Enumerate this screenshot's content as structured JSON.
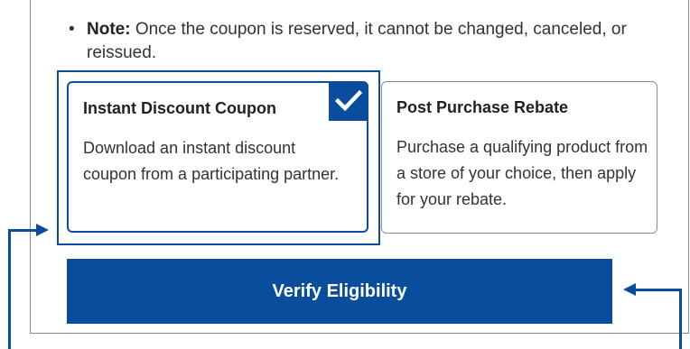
{
  "note": {
    "bullet": "•",
    "label": "Note:",
    "text": " Once the coupon is reserved, it cannot be changed, canceled, or reissued."
  },
  "options": [
    {
      "title": "Instant Discount Coupon",
      "description": "Download an instant discount coupon from a participating partner.",
      "selected": true
    },
    {
      "title": "Post Purchase Rebate",
      "description": "Purchase a qualifying product from a store of your choice, then apply for your rebate.",
      "selected": false
    }
  ],
  "verify_button": {
    "label": "Verify Eligibility"
  },
  "colors": {
    "accent": "#0a4d9c",
    "border": "#8a8a8a",
    "text": "#333333"
  },
  "icons": {
    "selected_check": "checkmark-icon",
    "annotation_arrows": "arrow-icon"
  }
}
